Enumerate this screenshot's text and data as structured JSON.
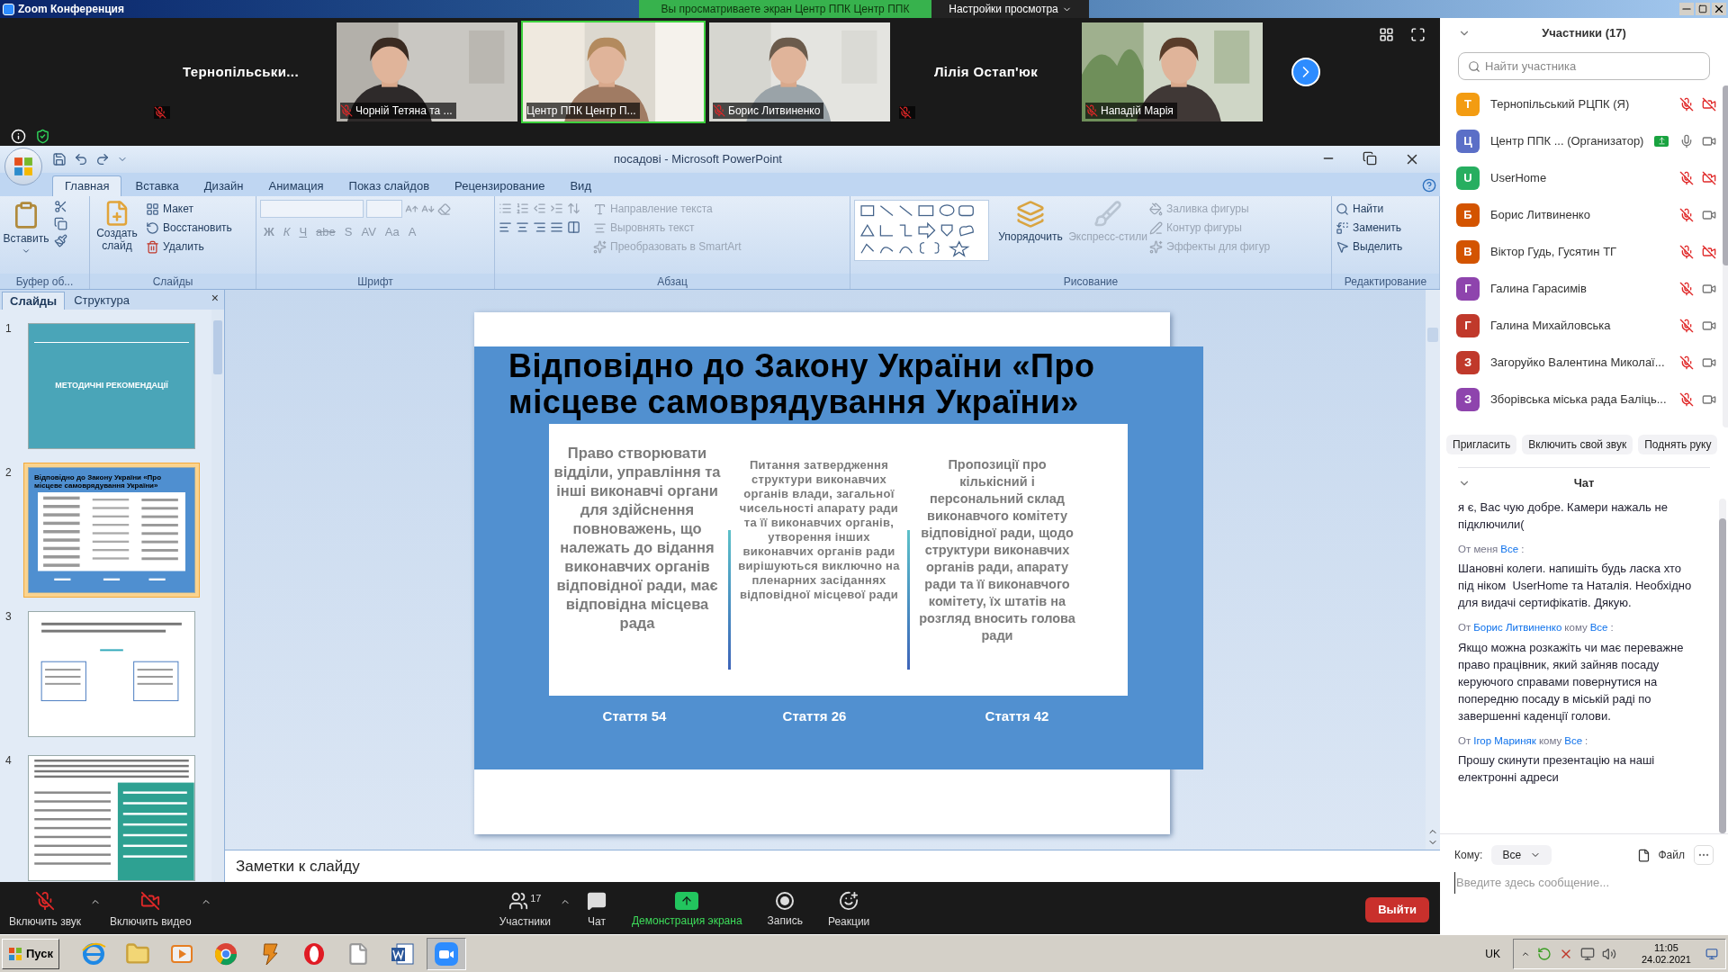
{
  "zoom_window": {
    "title": "Zoom Конференция",
    "share_banner": "Вы просматриваете экран Центр ППК Центр ППК",
    "view_settings": "Настройки просмотра"
  },
  "video_tiles": [
    {
      "kind": "name",
      "name": "Тернопільськи...",
      "muted": true,
      "selected": false
    },
    {
      "kind": "video",
      "name": "Чорній Тетяна та ...",
      "muted": true,
      "selected": false
    },
    {
      "kind": "video",
      "name": "Центр ППК Центр П...",
      "muted": false,
      "selected": true
    },
    {
      "kind": "video",
      "name": "Борис Литвиненко",
      "muted": true,
      "selected": false
    },
    {
      "kind": "name",
      "name": "Лілія Остап'юк",
      "muted": true,
      "selected": false
    },
    {
      "kind": "video",
      "name": "Нападій Марія",
      "muted": true,
      "selected": false
    }
  ],
  "powerpoint": {
    "title": "посадові - Microsoft PowerPoint",
    "tabs": [
      {
        "label": "Главная",
        "selected": true
      },
      {
        "label": "Вставка",
        "selected": false
      },
      {
        "label": "Дизайн",
        "selected": false
      },
      {
        "label": "Анимация",
        "selected": false
      },
      {
        "label": "Показ слайдов",
        "selected": false
      },
      {
        "label": "Рецензирование",
        "selected": false
      },
      {
        "label": "Вид",
        "selected": false
      }
    ],
    "ribbon": [
      {
        "label": "Буфер об...",
        "items": [
          {
            "label": "Вставить"
          }
        ]
      },
      {
        "label": "Слайды",
        "items": [
          {
            "label": "Создать слайд"
          },
          {
            "label": "Макет"
          },
          {
            "label": "Восстановить"
          },
          {
            "label": "Удалить"
          }
        ]
      },
      {
        "label": "Шрифт",
        "glyphs": [
          "Ж",
          "К",
          "Ч",
          "abe",
          "S",
          "AV",
          "Aa",
          "A"
        ]
      },
      {
        "label": "Абзац",
        "items": [
          {
            "label": "Направление текста",
            "disabled": true
          },
          {
            "label": "Выровнять текст",
            "disabled": true
          },
          {
            "label": "Преобразовать в SmartArt",
            "disabled": true
          }
        ]
      },
      {
        "label": "Рисование",
        "items": [
          {
            "label": "Упорядочить",
            "disabled": false
          },
          {
            "label": "Экспресс-стили",
            "disabled": true
          },
          {
            "label": "Заливка фигуры",
            "disabled": true
          },
          {
            "label": "Контур фигуры",
            "disabled": true
          },
          {
            "label": "Эффекты для фигур",
            "disabled": true
          }
        ]
      },
      {
        "label": "Редактирование",
        "items": [
          {
            "label": "Найти"
          },
          {
            "label": "Заменить"
          },
          {
            "label": "Выделить"
          }
        ]
      }
    ],
    "pane_tabs": [
      {
        "label": "Слайды",
        "selected": true
      },
      {
        "label": "Структура",
        "selected": false
      }
    ],
    "pane_close": "×",
    "thumbnails": [
      {
        "number": "1",
        "selected": false,
        "title": "МЕТОДИЧНІ РЕКОМЕНДАЦІЇ"
      },
      {
        "number": "2",
        "selected": true,
        "title": "Відповідно до Закону України «Про місцеве самоврядування України»"
      },
      {
        "number": "3",
        "selected": false
      },
      {
        "number": "4",
        "selected": false
      }
    ],
    "slide": {
      "title": "Відповідно до Закону України «Про місцеве самоврядування України»",
      "columns": [
        {
          "text": "Право створювати відділи, управління та інші виконавчі органи для здійснення повноважень, що належать до відання виконавчих органів відповідної ради, має відповідна місцева рада",
          "caption": "Стаття 54"
        },
        {
          "text": "Питання затвердження структури виконавчих органів влади, загальної чисельності апарату ради та її виконавчих органів, утворення інших виконавчих органів ради вирішуються виключно на пленарних засіданнях відповідної місцевої ради",
          "caption": "Стаття 26"
        },
        {
          "text": "Пропозиції про кількісний і персональний склад виконавчого комітету відповідної ради, щодо структури виконавчих органів ради, апарату ради та її виконавчого комітету, їх штатів на розгляд вносить голова ради",
          "caption": "Стаття 42"
        }
      ]
    },
    "notes_placeholder": "Заметки к слайду"
  },
  "participants": {
    "title": "Участники (17)",
    "search_placeholder": "Найти участника",
    "items": [
      {
        "initial": "Т",
        "color": "#f39c12",
        "name": "Тернопільський РЦПК (Я)",
        "mic_muted": true,
        "video_off": true,
        "sharing": false
      },
      {
        "initial": "Ц",
        "color": "#5b6fc7",
        "name": "Центр ППК ... (Организатор)",
        "mic_muted": false,
        "video_off": false,
        "sharing": true
      },
      {
        "initial": "U",
        "color": "#27ae60",
        "name": "UserHome",
        "mic_muted": true,
        "video_off": true,
        "sharing": false
      },
      {
        "initial": "Б",
        "color": "#d35400",
        "name": "Борис Литвиненко",
        "mic_muted": true,
        "video_off": false,
        "sharing": false
      },
      {
        "initial": "В",
        "color": "#d35400",
        "name": "Віктор Гудь, Гусятин ТГ",
        "mic_muted": true,
        "video_off": true,
        "sharing": false
      },
      {
        "initial": "Г",
        "color": "#8e44ad",
        "name": "Галина Гарасимів",
        "mic_muted": true,
        "video_off": false,
        "sharing": false
      },
      {
        "initial": "Г",
        "color": "#c0392b",
        "name": "Галина Михайловська",
        "mic_muted": true,
        "video_off": false,
        "sharing": false
      },
      {
        "initial": "З",
        "color": "#c0392b",
        "name": "Загоруйко Валентина Миколаї...",
        "mic_muted": true,
        "video_off": false,
        "sharing": false
      },
      {
        "initial": "З",
        "color": "#8e44ad",
        "name": "Зборівська міська рада Баліць...",
        "mic_muted": true,
        "video_off": false,
        "sharing": false
      }
    ],
    "buttons": [
      "Пригласить",
      "Включить свой звук",
      "Поднять руку"
    ]
  },
  "chat": {
    "title": "Чат",
    "messages": [
      {
        "text": "я є, Вас чую добре. Камери нажаль не підключили("
      },
      {
        "header": [
          {
            "kind": "meta",
            "text": "От меня"
          },
          {
            "kind": "name",
            "text": "Все"
          },
          {
            "kind": "meta",
            "text": ":"
          }
        ],
        "text": "Шановні колеги. напишіть будь ласка хто під ніком  UserHome та Наталія. Необхідно для видачі сертифікатів. Дякую."
      },
      {
        "header": [
          {
            "kind": "meta",
            "text": "От"
          },
          {
            "kind": "name",
            "text": "Борис Литвиненко"
          },
          {
            "kind": "meta",
            "text": "кому"
          },
          {
            "kind": "name",
            "text": "Все"
          },
          {
            "kind": "meta",
            "text": ":"
          }
        ],
        "text": "Якщо можна розкажіть чи має переважне право працівник, який зайняв посаду керуючого справами повернутися на попередню посаду в міській раді по завершенні каденції голови."
      },
      {
        "header": [
          {
            "kind": "meta",
            "text": "От"
          },
          {
            "kind": "name",
            "text": "Ігор Мариняк"
          },
          {
            "kind": "meta",
            "text": "кому"
          },
          {
            "kind": "name",
            "text": "Все"
          },
          {
            "kind": "meta",
            "text": ":"
          }
        ],
        "text": "Прошу скинути презентацію на наші електронні адреси"
      }
    ],
    "to_label": "Кому:",
    "to_value": "Все",
    "file": "Файл",
    "placeholder": "Введите здесь сообщение..."
  },
  "toolbar": {
    "items": [
      {
        "kind": "mic",
        "label": "Включить звук",
        "off": true
      },
      {
        "kind": "video",
        "label": "Включить видео",
        "off": true
      },
      {
        "kind": "participants",
        "label": "Участники",
        "count": "17"
      },
      {
        "kind": "chat",
        "label": "Чат"
      },
      {
        "kind": "share",
        "label": "Демонстрация экрана"
      },
      {
        "kind": "record",
        "label": "Запись"
      },
      {
        "kind": "reactions",
        "label": "Реакции"
      }
    ],
    "leave": "Выйти"
  },
  "taskbar": {
    "start": "Пуск",
    "apps": [
      {
        "kind": "browser",
        "selected": false
      },
      {
        "kind": "folder",
        "selected": false
      },
      {
        "kind": "player",
        "selected": false
      },
      {
        "kind": "chrome",
        "selected": false
      },
      {
        "kind": "archive",
        "selected": false
      },
      {
        "kind": "opera",
        "selected": false
      },
      {
        "kind": "file",
        "selected": false
      },
      {
        "kind": "word",
        "selected": false
      },
      {
        "kind": "zoom",
        "selected": true
      }
    ],
    "language": "UK",
    "time": "11:05",
    "date": "24.02.2021"
  }
}
